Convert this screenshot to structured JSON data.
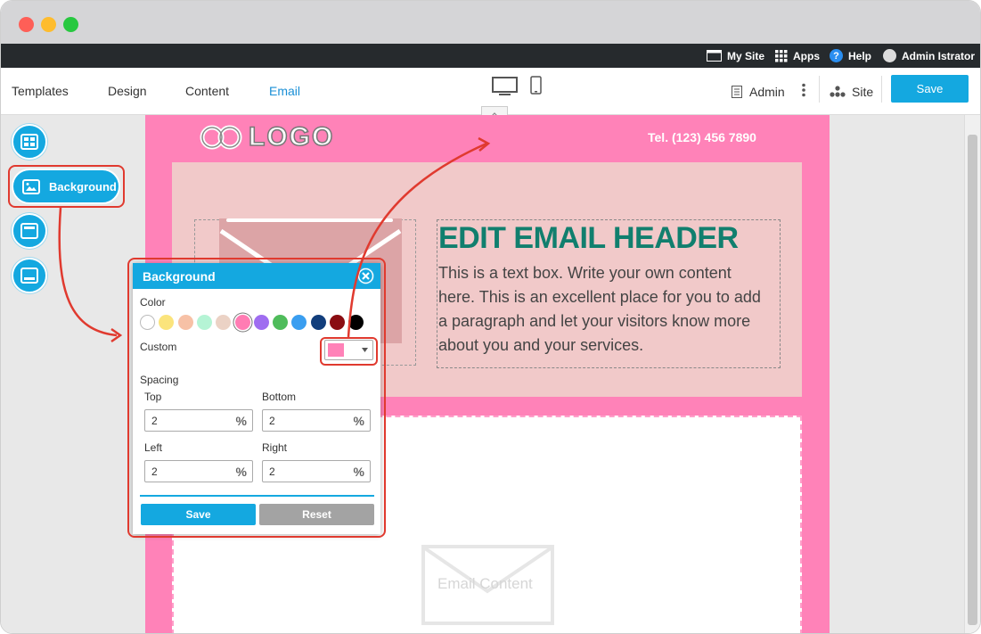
{
  "window": {
    "traffic_lights": [
      "#fe5f57",
      "#febc2e",
      "#28c840"
    ]
  },
  "topbar": {
    "my_site": "My Site",
    "apps": "Apps",
    "help": "Help",
    "user": "Admin Istrator"
  },
  "nav": {
    "tabs": [
      "Templates",
      "Design",
      "Content",
      "Email"
    ],
    "active_tab": "Email",
    "admin": "Admin",
    "site": "Site",
    "save": "Save"
  },
  "sidebar": {
    "background_label": "Background"
  },
  "email": {
    "logo": "LOGO",
    "phone": "Tel. (123) 456 7890",
    "header_title": "EDIT EMAIL HEADER",
    "header_text": "This is a text box. Write your own content here. This is an excellent place for you to add a paragraph and let your visitors know more about you and your services.",
    "content_placeholder": "Email Content"
  },
  "background_dialog": {
    "title": "Background",
    "color_label": "Color",
    "swatches": [
      "#ffffff",
      "#fbe47c",
      "#f7c1a6",
      "#b5f4d5",
      "#ebd2c5",
      "#ff7cb3",
      "#9f6df0",
      "#4fbc5b",
      "#3a9ef0",
      "#123e7c",
      "#8a0d12",
      "#000000"
    ],
    "selected_swatch": "#ff7cb3",
    "custom_label": "Custom",
    "custom_color": "#ff82b8",
    "spacing_label": "Spacing",
    "top_label": "Top",
    "top_value": "2",
    "bottom_label": "Bottom",
    "bottom_value": "2",
    "left_label": "Left",
    "left_value": "2",
    "right_label": "Right",
    "right_value": "2",
    "unit": "%",
    "save": "Save",
    "reset": "Reset"
  },
  "colors": {
    "accent": "#14a8e0",
    "canvas_bg": "#ff82b8",
    "header_bg": "#f1c9c9",
    "heading": "#117f6e",
    "annotation": "#e03a2f"
  }
}
